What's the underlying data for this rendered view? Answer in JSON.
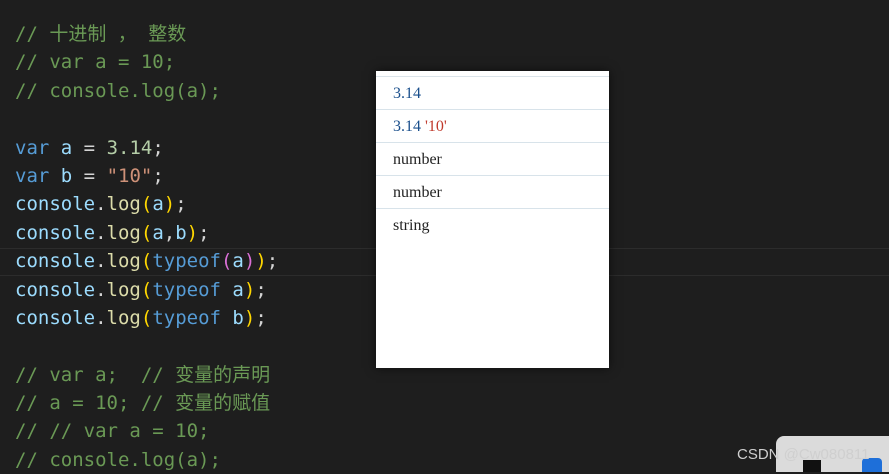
{
  "code": {
    "line1": "// 十进制 ， 整数",
    "line2": "// var a = 10;",
    "line3": "// console.log(a);",
    "line5": {
      "kw": "var",
      "name": "a",
      "op": " = ",
      "val": "3.14",
      "end": ";"
    },
    "line6": {
      "kw": "var",
      "name": "b",
      "op": " = ",
      "val": "\"10\"",
      "end": ";"
    },
    "line7": {
      "obj": "console",
      "dot": ".",
      "fn": "log",
      "open": "(",
      "arg": "a",
      "close": ")",
      "end": ";"
    },
    "line8": {
      "obj": "console",
      "dot": ".",
      "fn": "log",
      "open": "(",
      "arg1": "a",
      "comma": ",",
      "arg2": "b",
      "close": ")",
      "end": ";"
    },
    "line9": {
      "obj": "console",
      "dot": ".",
      "fn": "log",
      "open": "(",
      "tp": "typeof",
      "open2": "(",
      "arg": "a",
      "close2": ")",
      "close": ")",
      "end": ";"
    },
    "line10": {
      "obj": "console",
      "dot": ".",
      "fn": "log",
      "open": "(",
      "tp": "typeof",
      "sp": " ",
      "arg": "a",
      "close": ")",
      "end": ";"
    },
    "line11": {
      "obj": "console",
      "dot": ".",
      "fn": "log",
      "open": "(",
      "tp": "typeof",
      "sp": " ",
      "arg": "b",
      "close": ")",
      "end": ";"
    },
    "line13": "// var a;  // 变量的声明",
    "line14": "// a = 10; // 变量的赋值",
    "line15": "// // var a = 10;",
    "line16": "// console.log(a);"
  },
  "console": {
    "row1": "3.14",
    "row2_num": "3.14",
    "row2_str": " '10'",
    "row3": "number",
    "row4": "number",
    "row5": "string"
  },
  "watermark": "CSDN @Cw080811",
  "colors": {
    "background": "#1e1e1e",
    "comment": "#6a9955",
    "keyword": "#569cd6",
    "string": "#ce9178",
    "number": "#b5cea8",
    "function": "#dcdcaa"
  }
}
